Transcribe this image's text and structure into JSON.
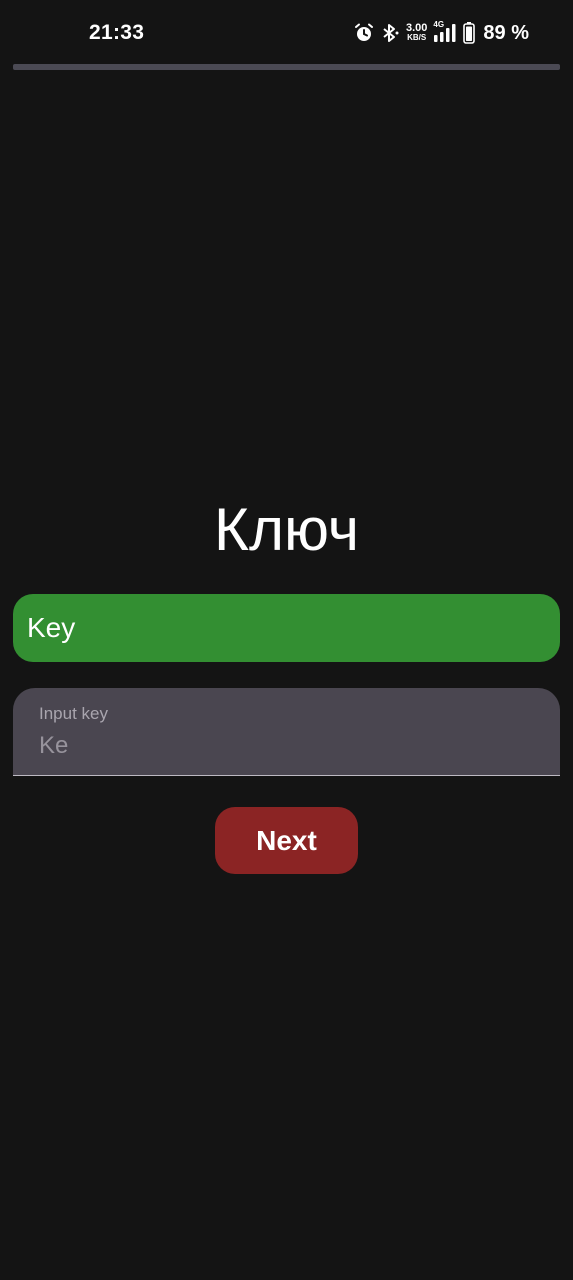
{
  "status_bar": {
    "time": "21:33",
    "net_speed_value": "3.00",
    "net_speed_unit": "KB/S",
    "network_type": "4G",
    "battery_percent": "89 %",
    "icons": [
      "alarm-icon",
      "bluetooth-icon",
      "signal-icon",
      "battery-icon"
    ]
  },
  "page": {
    "title": "Ключ",
    "key_banner": "Key"
  },
  "input": {
    "label": "Input key",
    "value": "",
    "placeholder": "Ke"
  },
  "actions": {
    "next_label": "Next"
  },
  "colors": {
    "background": "#141414",
    "key_banner": "#338f32",
    "input_fill": "#4a4650",
    "next_button": "#8b2424",
    "progress_track": "#4b4a54"
  }
}
